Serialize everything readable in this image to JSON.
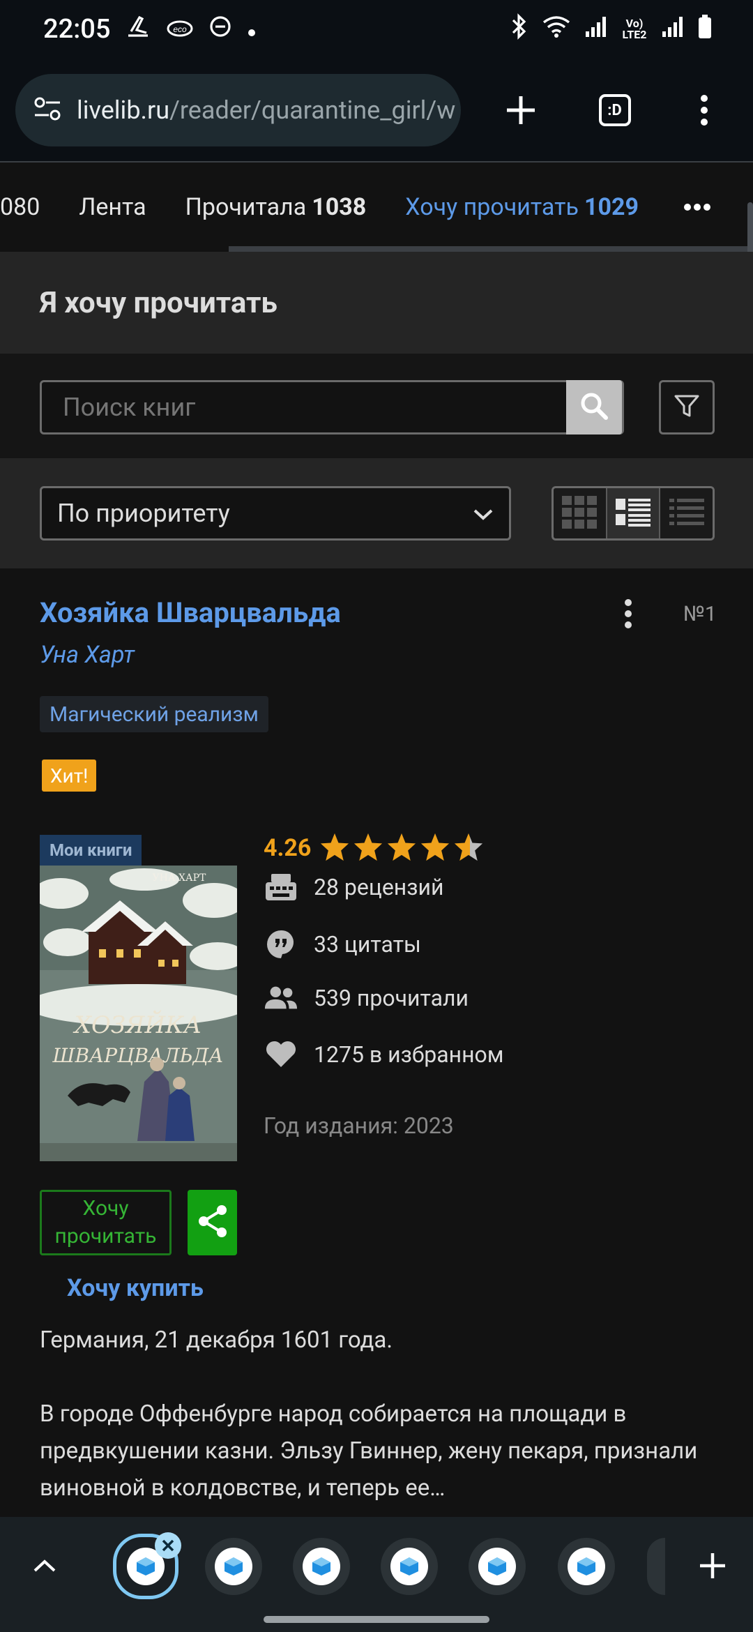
{
  "status_bar": {
    "time": "22:05",
    "network_label": "Vo) LTE2",
    "icons": [
      "airplane-icon",
      "cloud-icon",
      "dnd-icon",
      "dot-icon",
      "bluetooth-icon",
      "wifi-icon",
      "signal-icon",
      "signal-icon",
      "battery-icon"
    ]
  },
  "browser": {
    "url_host": "livelib.ru",
    "url_path": "/reader/quarantine_girl/w",
    "tab_count": ":D",
    "icons": [
      "site-settings-icon",
      "new-tab-icon",
      "tab-switcher-icon",
      "menu-icon"
    ]
  },
  "nav_tabs": [
    {
      "label": "",
      "count": "080"
    },
    {
      "label": "Лента",
      "count": ""
    },
    {
      "label": "Прочитала",
      "count": "1038"
    },
    {
      "label": "Хочу прочитать",
      "count": "1029",
      "active": true
    }
  ],
  "section": {
    "title": "Я хочу прочитать"
  },
  "search": {
    "placeholder": "Поиск книг"
  },
  "sort": {
    "selected": "По приоритету"
  },
  "book": {
    "title": "Хозяйка Шварцвальда",
    "author": "Уна Харт",
    "number": "№1",
    "genre": "Магический реализм",
    "badge": "Хит!",
    "my_books_label": "Мои книги",
    "cover_author": "УНА ХАРТ",
    "cover_title_line1": "ХОЗЯЙКА",
    "cover_title_line2": "ШВАРЦВАЛЬДА",
    "rating": "4.26",
    "rating_value": 4.26,
    "stats": {
      "reviews": "28 рецензий",
      "quotes": "33 цитаты",
      "readers": "539 прочитали",
      "favorites": "1275 в избранном"
    },
    "year": "Год издания: 2023",
    "want_button": "Хочу прочитать",
    "buy_link": "Хочу купить",
    "description_p1": "Германия, 21 декабря 1601 года.",
    "description_p2": "В городе Оффенбурге народ собирается на площади в предвкушении казни. Эльзу Гвиннер, жену пекаря, признали виновной в колдовстве, и теперь ее…"
  },
  "colors": {
    "link_blue": "#5d9ae8",
    "star_orange": "#f0a21b",
    "green": "#12a012",
    "background": "#121212"
  }
}
